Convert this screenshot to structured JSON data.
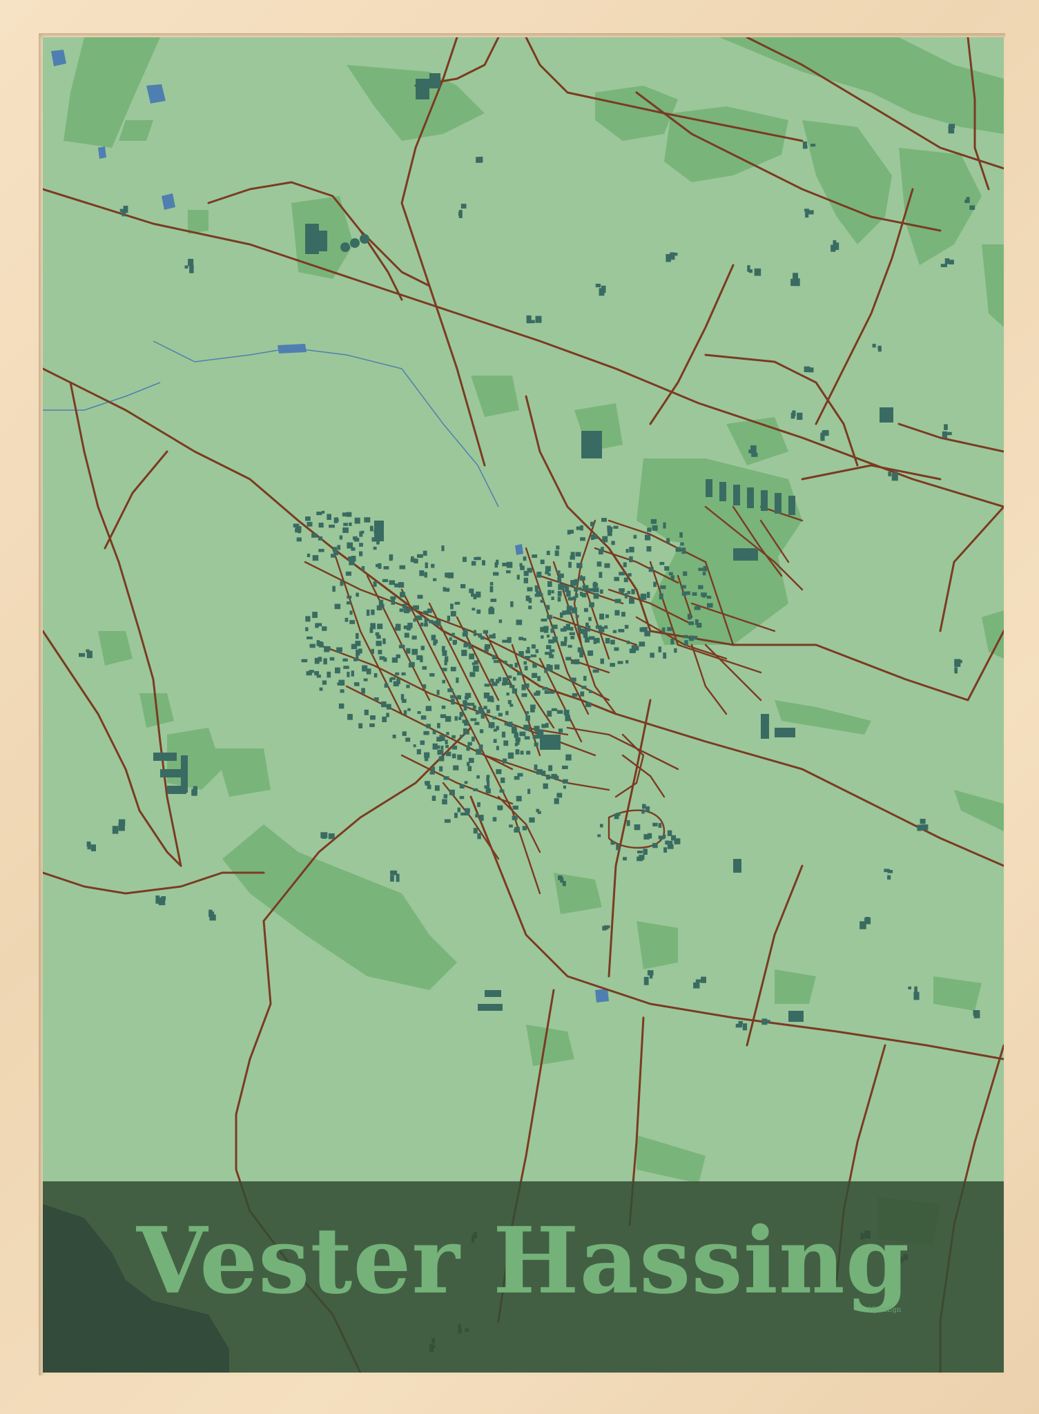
{
  "poster": {
    "title": "Vester Hassing",
    "brand": "HjemEgn"
  },
  "colors": {
    "frame": "#f2dcbc",
    "land": "#9cc79a",
    "forest": "#76b277",
    "roads": "#7a3b22",
    "buildings": "#3a6b62",
    "water": "#4f7fb0",
    "sea": "#2b4560",
    "title_band": "#344c34",
    "title_text": "#74b27a"
  },
  "icons": {
    "frame": "wooden-frame",
    "map": "street-map"
  }
}
